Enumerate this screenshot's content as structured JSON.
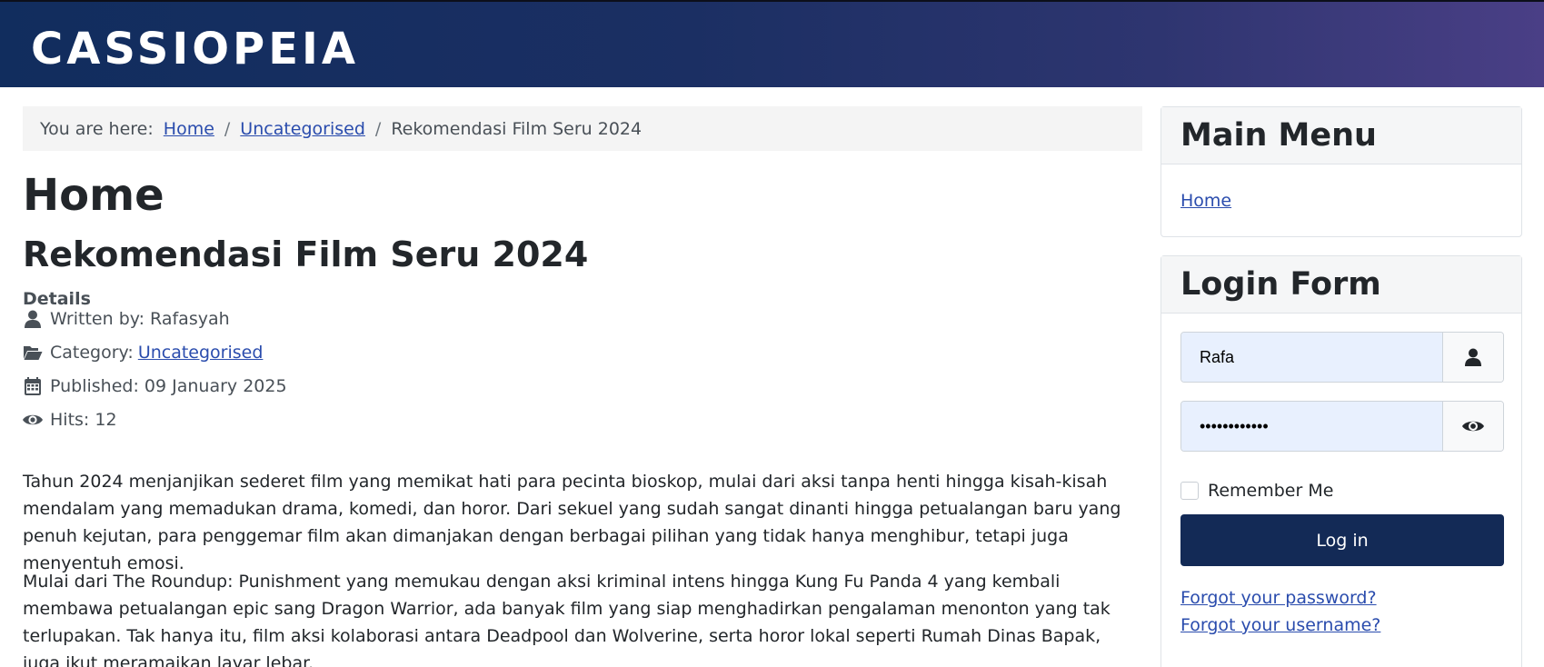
{
  "header": {
    "brand": "CASSIOPEIA"
  },
  "breadcrumb": {
    "prefix": "You are here:",
    "items": [
      "Home",
      "Uncategorised",
      "Rekomendasi Film Seru 2024"
    ],
    "separator": "/"
  },
  "page": {
    "heading": "Home",
    "article_title": "Rekomendasi Film Seru 2024"
  },
  "details": {
    "label": "Details",
    "written_by": "Written by: Rafasyah",
    "category_label": "Category:",
    "category_value": "Uncategorised",
    "published": "Published: 09 January 2025",
    "hits": "Hits: 12"
  },
  "article": {
    "paragraphs": [
      "Tahun 2024 menjanjikan sederet film yang memikat hati para pecinta bioskop, mulai dari aksi tanpa henti hingga kisah-kisah mendalam yang memadukan drama, komedi, dan horor. Dari sekuel yang sudah sangat dinanti hingga petualangan baru yang penuh kejutan, para penggemar film akan dimanjakan dengan berbagai pilihan yang tidak hanya menghibur, tetapi juga menyentuh emosi.",
      "Mulai dari The Roundup: Punishment yang memukau dengan aksi kriminal intens hingga Kung Fu Panda 4 yang kembali membawa petualangan epic sang Dragon Warrior, ada banyak film yang siap menghadirkan pengalaman menonton yang tak terlupakan. Tak hanya itu, film aksi kolaborasi antara Deadpool dan Wolverine, serta horor lokal seperti Rumah Dinas Bapak, juga ikut meramaikan layar lebar."
    ]
  },
  "sidebar": {
    "main_menu": {
      "title": "Main Menu",
      "items": [
        "Home"
      ]
    },
    "login_form": {
      "title": "Login Form",
      "username_value": "Rafa",
      "password_value": "••••••••••••",
      "remember_label": "Remember Me",
      "login_label": "Log in",
      "forgot_password": "Forgot your password?",
      "forgot_username": "Forgot your username?"
    }
  },
  "colors": {
    "header_start": "#112d5e",
    "header_end": "#4a3f86",
    "link": "#2a4cad",
    "button": "#132a56",
    "input_bg": "#e8f0fe"
  },
  "icons": {
    "author": "user-icon",
    "category": "folder-open-icon",
    "published": "calendar-icon",
    "hits": "eye-icon",
    "username_addon": "user-icon",
    "password_addon": "eye-icon"
  }
}
